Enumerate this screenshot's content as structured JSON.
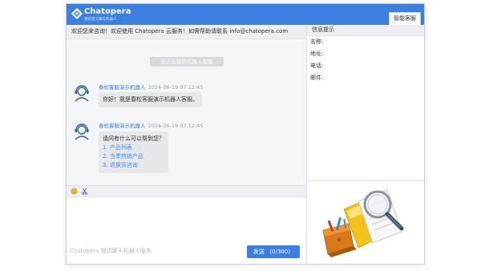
{
  "header": {
    "logo_name": "Chatopera",
    "logo_sub": "重新定义聊天机器人",
    "tab_label": "智能客服"
  },
  "chat": {
    "notice": "欢迎您来咨询！欢迎使用 Chatopera 云服务！如需帮助请联系 info@chatopera.com",
    "divider": "您正在使用机器人客服",
    "messages": [
      {
        "sender": "春松客服演示机器人",
        "time": "2024-06-19 07:12:45",
        "lines": [
          "你好！我是春松客服演示机器人客服。"
        ]
      },
      {
        "sender": "春松客服演示机器人",
        "time": "2024-06-19 07:12:45",
        "lines": [
          "请问有什么可以帮到您？"
        ],
        "links": [
          "1. 产品列表",
          "2. 当季热销产品",
          "3. 退换货咨询"
        ]
      }
    ]
  },
  "toolbar": {
    "icons": [
      "emoji-icon",
      "scissors-icon"
    ]
  },
  "input": {
    "placeholder": "Chatopera 提供聊天机器人服务",
    "send_label": "发送 （0/300）"
  },
  "side": {
    "title": "信息提示",
    "fields": [
      "名称:",
      "地址:",
      "电话:",
      "邮件:"
    ]
  },
  "colors": {
    "brand": "#3b7fe0",
    "link": "#4a90e2"
  }
}
